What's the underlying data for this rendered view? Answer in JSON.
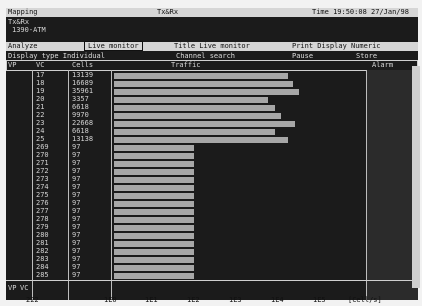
{
  "header": {
    "title_left": "Mapping",
    "title_center": "Tx&Rx",
    "time": "Time 19:50:08 27/Jan/98",
    "sub1": "Tx&Rx",
    "sub2": "1390-ATM"
  },
  "menu": {
    "analyze": "Analyze",
    "live_monitor": "Live monitor",
    "title_live_monitor": "Title Live monitor",
    "print_display": "Print Display Numeric",
    "display_type": "Display type Individual",
    "channel_search": "Channel search",
    "pause": "Pause",
    "store": "Store"
  },
  "columns": {
    "vp": "VP",
    "vc": "VC",
    "cells": "Cells",
    "traffic": "Traffic",
    "alarm": "Alarm"
  },
  "footer": {
    "vp": "VP",
    "vc": "VC",
    "cells_per_s": "[Cell/s]",
    "ticks": [
      "222",
      "1E0",
      "1E1",
      "1E2",
      "1E3",
      "1E4",
      "1E5"
    ]
  },
  "rows": [
    {
      "vc": "17",
      "cells": "13139",
      "traffic_pct": 94
    },
    {
      "vc": "18",
      "cells": "16689",
      "traffic_pct": 97
    },
    {
      "vc": "19",
      "cells": "35961",
      "traffic_pct": 100
    },
    {
      "vc": "20",
      "cells": "3357",
      "traffic_pct": 83
    },
    {
      "vc": "21",
      "cells": "6618",
      "traffic_pct": 87
    },
    {
      "vc": "22",
      "cells": "9970",
      "traffic_pct": 90
    },
    {
      "vc": "23",
      "cells": "22668",
      "traffic_pct": 98
    },
    {
      "vc": "24",
      "cells": "6618",
      "traffic_pct": 87
    },
    {
      "vc": "25",
      "cells": "13138",
      "traffic_pct": 94
    },
    {
      "vc": "269",
      "cells": "97",
      "traffic_pct": 43
    },
    {
      "vc": "270",
      "cells": "97",
      "traffic_pct": 43
    },
    {
      "vc": "271",
      "cells": "97",
      "traffic_pct": 43
    },
    {
      "vc": "272",
      "cells": "97",
      "traffic_pct": 43
    },
    {
      "vc": "273",
      "cells": "97",
      "traffic_pct": 43
    },
    {
      "vc": "274",
      "cells": "97",
      "traffic_pct": 43
    },
    {
      "vc": "275",
      "cells": "97",
      "traffic_pct": 43
    },
    {
      "vc": "276",
      "cells": "97",
      "traffic_pct": 43
    },
    {
      "vc": "277",
      "cells": "97",
      "traffic_pct": 43
    },
    {
      "vc": "278",
      "cells": "97",
      "traffic_pct": 43
    },
    {
      "vc": "279",
      "cells": "97",
      "traffic_pct": 43
    },
    {
      "vc": "280",
      "cells": "97",
      "traffic_pct": 43
    },
    {
      "vc": "281",
      "cells": "97",
      "traffic_pct": 43
    },
    {
      "vc": "282",
      "cells": "97",
      "traffic_pct": 43
    },
    {
      "vc": "283",
      "cells": "97",
      "traffic_pct": 43
    },
    {
      "vc": "284",
      "cells": "97",
      "traffic_pct": 43
    },
    {
      "vc": "285",
      "cells": "97",
      "traffic_pct": 43
    }
  ],
  "colors": {
    "background": "#1b1b1b",
    "bar": "#a7a7a7",
    "text": "#d6d6d6",
    "axis_area": "#f2f2f2"
  }
}
